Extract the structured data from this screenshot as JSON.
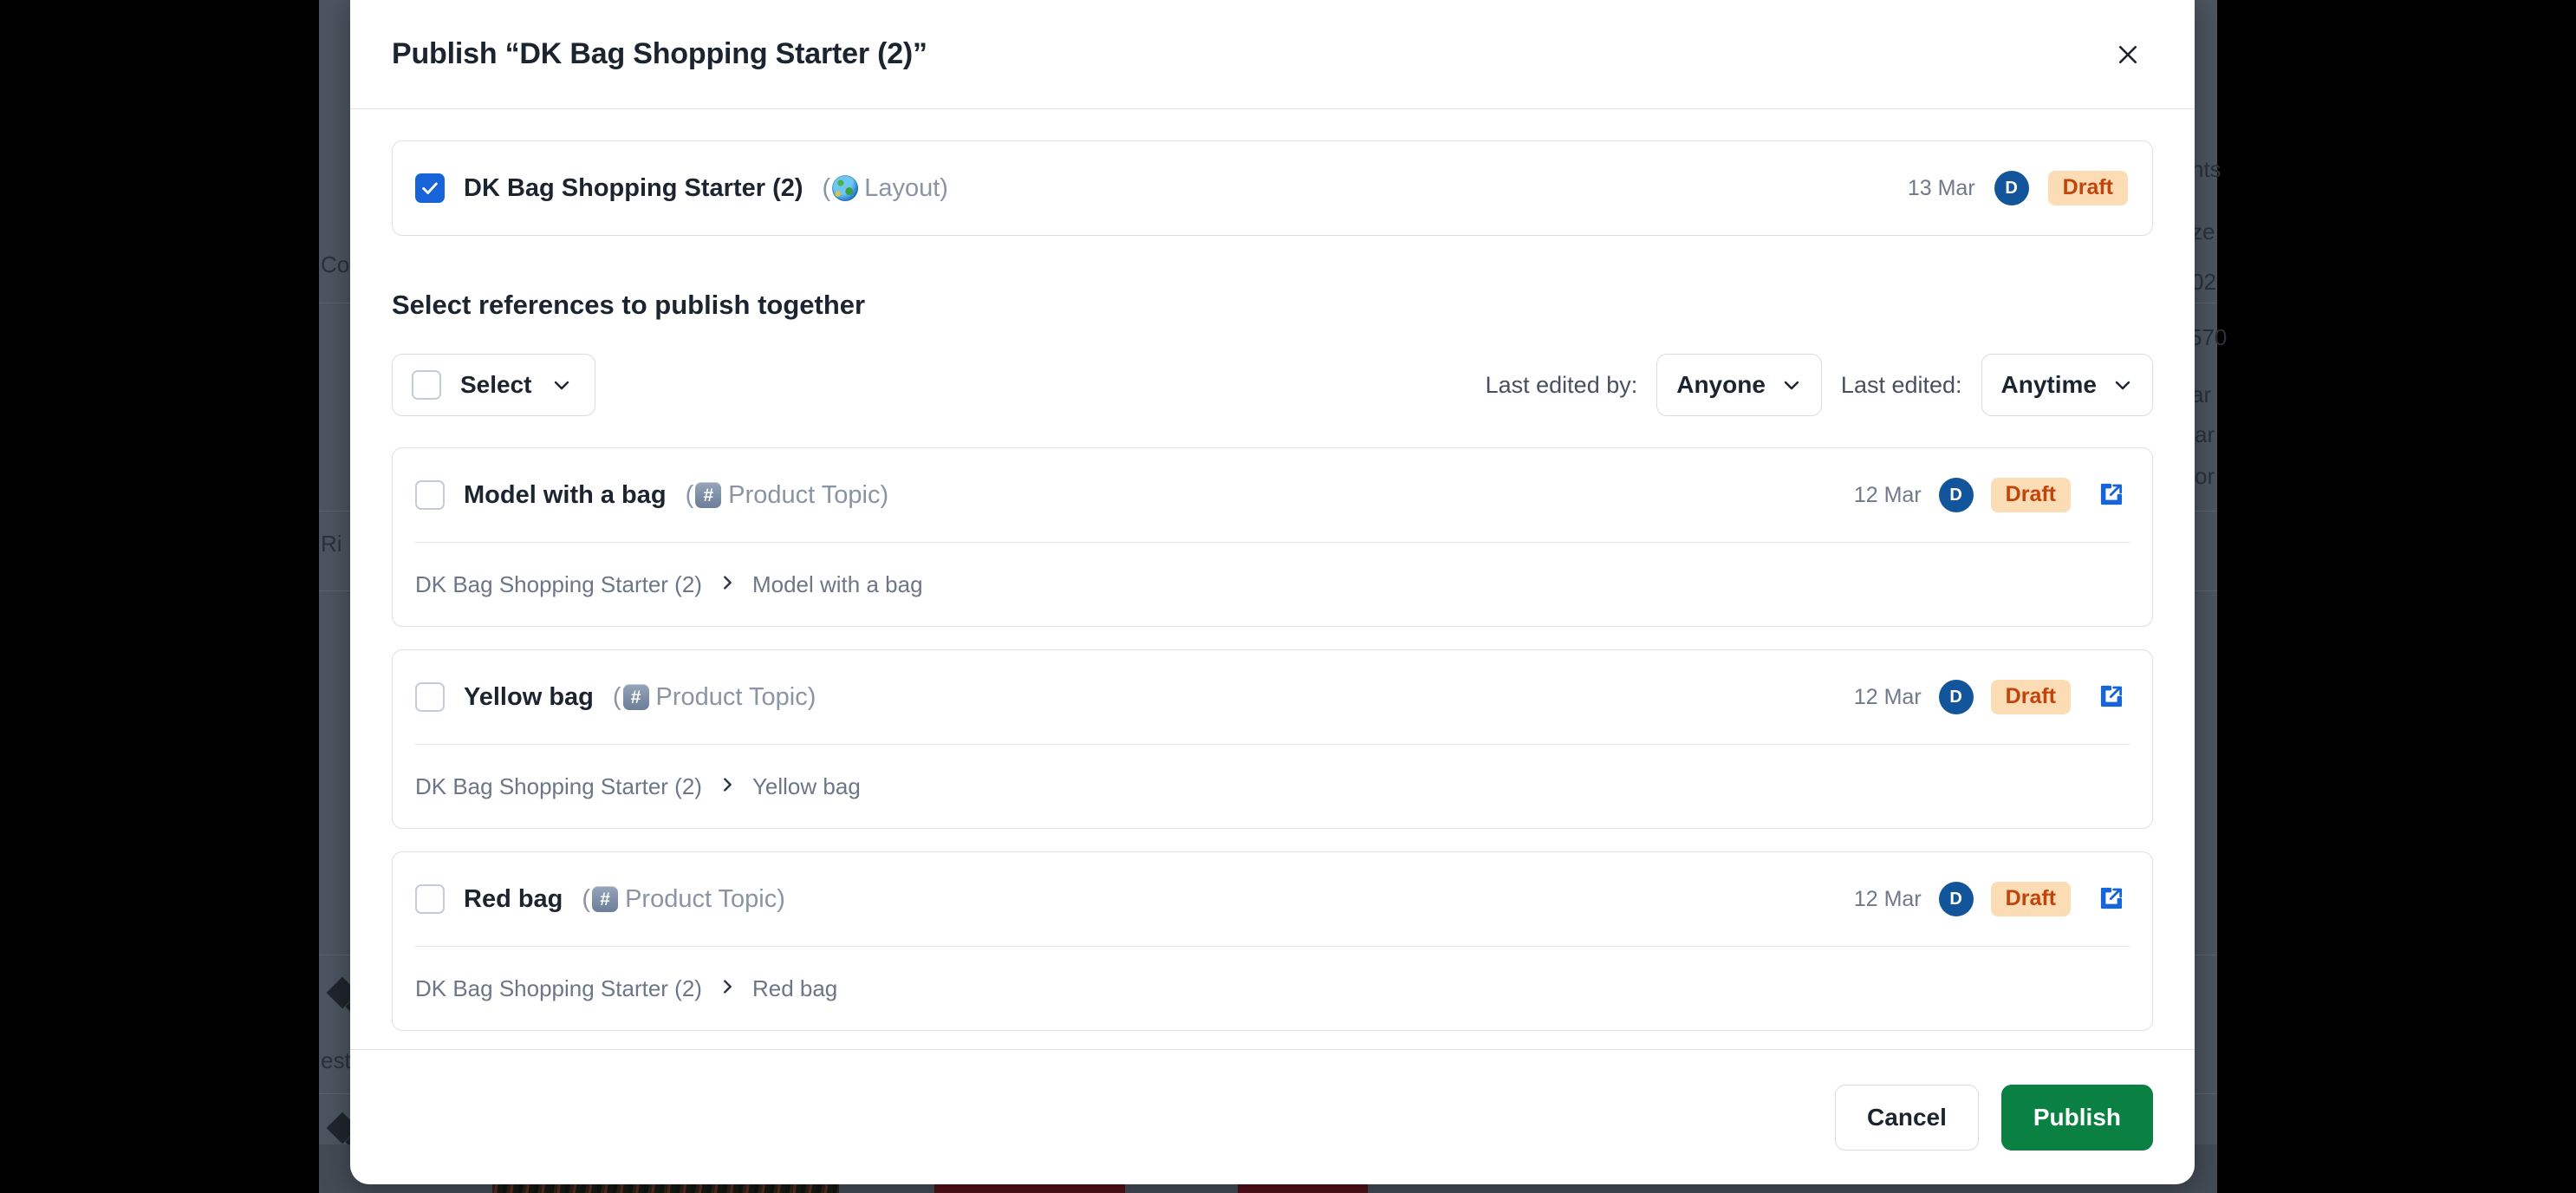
{
  "modal": {
    "title": "Publish “DK Bag Shopping Starter (2)”",
    "close_icon": "close-icon"
  },
  "primary_item": {
    "checked": true,
    "title": "DK Bag Shopping Starter (2)",
    "type_open_paren": "(",
    "type_icon": "globe-icon",
    "type_label": "Layout",
    "type_close_paren": ")",
    "date": "13 Mar",
    "avatar_initial": "D",
    "status": "Draft"
  },
  "references_section": {
    "heading": "Select references to publish together",
    "select_button": {
      "label": "Select",
      "checked": false,
      "chevron_icon": "chevron-down-icon"
    },
    "filters": [
      {
        "label": "Last edited by:",
        "value": "Anyone",
        "chevron_icon": "chevron-down-icon"
      },
      {
        "label": "Last edited:",
        "value": "Anytime",
        "chevron_icon": "chevron-down-icon"
      }
    ],
    "items": [
      {
        "checked": false,
        "title": "Model with a bag",
        "type_open_paren": "(",
        "type_icon": "hash-icon",
        "type_glyph": "#",
        "type_label": "Product Topic",
        "type_close_paren": ")",
        "date": "12 Mar",
        "avatar_initial": "D",
        "status": "Draft",
        "open_icon": "external-link-icon",
        "breadcrumb": [
          "DK Bag Shopping Starter (2)",
          "Model with a bag"
        ]
      },
      {
        "checked": false,
        "title": "Yellow bag",
        "type_open_paren": "(",
        "type_icon": "hash-icon",
        "type_glyph": "#",
        "type_label": "Product Topic",
        "type_close_paren": ")",
        "date": "12 Mar",
        "avatar_initial": "D",
        "status": "Draft",
        "open_icon": "external-link-icon",
        "breadcrumb": [
          "DK Bag Shopping Starter (2)",
          "Yellow bag"
        ]
      },
      {
        "checked": false,
        "title": "Red bag",
        "type_open_paren": "(",
        "type_icon": "hash-icon",
        "type_glyph": "#",
        "type_label": "Product Topic",
        "type_close_paren": ")",
        "date": "12 Mar",
        "avatar_initial": "D",
        "status": "Draft",
        "open_icon": "external-link-icon",
        "breadcrumb": [
          "DK Bag Shopping Starter (2)",
          "Red bag"
        ]
      }
    ]
  },
  "footer": {
    "cancel_label": "Cancel",
    "publish_label": "Publish"
  },
  "background": {
    "texts": [
      "Co",
      "Ri",
      "est",
      "nts",
      "ze",
      "02",
      "570",
      "ar",
      "ar",
      "or"
    ]
  },
  "colors": {
    "accent_blue": "#1664d8",
    "avatar_blue": "#13559b",
    "draft_badge_bg": "#fbdcb5",
    "draft_badge_text": "#c3440a",
    "publish_green": "#0a8043",
    "modal_bg": "#ffffff",
    "overlay": "#4c5560"
  }
}
